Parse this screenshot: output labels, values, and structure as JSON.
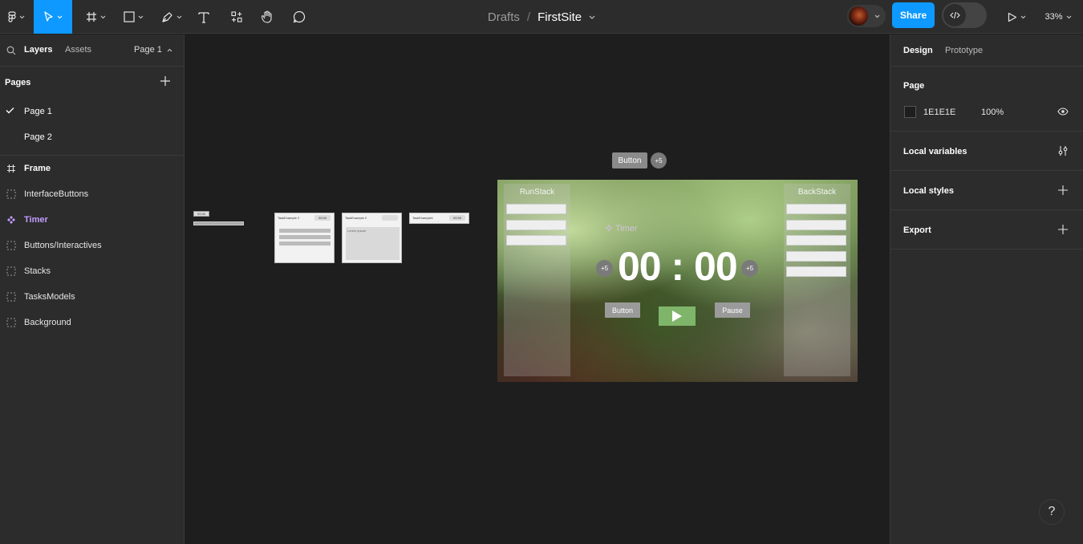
{
  "topbar": {
    "tools": [
      "main-menu",
      "move-tool",
      "frame-tool",
      "shape-tool",
      "pen-tool",
      "text-tool",
      "resources-tool",
      "hand-tool",
      "comment-tool"
    ],
    "breadcrumb": {
      "folder": "Drafts",
      "separator": "/",
      "file": "FirstSite"
    },
    "share_label": "Share",
    "zoom": "33%"
  },
  "left_panel": {
    "tabs": {
      "layers": "Layers",
      "assets": "Assets",
      "page": "Page 1"
    },
    "pages_title": "Pages",
    "pages": [
      {
        "label": "Page 1",
        "selected": true
      },
      {
        "label": "Page 2",
        "selected": false
      }
    ],
    "layers": [
      {
        "label": "Frame",
        "type": "frame"
      },
      {
        "label": "InterfaceButtons",
        "type": "section"
      },
      {
        "label": "Timer",
        "type": "component"
      },
      {
        "label": "Buttons/Interactives",
        "type": "section"
      },
      {
        "label": "Stacks",
        "type": "section"
      },
      {
        "label": "TasksModels",
        "type": "section"
      },
      {
        "label": "Background",
        "type": "section"
      }
    ]
  },
  "right_panel": {
    "tabs": {
      "design": "Design",
      "prototype": "Prototype"
    },
    "page_section": {
      "title": "Page",
      "color_hex": "1E1E1E",
      "opacity": "100%"
    },
    "local_variables": "Local variables",
    "local_styles": "Local styles",
    "export": "Export",
    "help": "?"
  },
  "canvas": {
    "mini_time": "00:00",
    "task_cards": [
      {
        "title": "TaskExample 2",
        "time": "00:00"
      },
      {
        "title": "TaskExample 2",
        "time": "",
        "body": "Lorem ipsum"
      },
      {
        "title": "TaskExample1",
        "time": "00:59"
      }
    ],
    "floating_button": "Button",
    "floating_plus": "+5",
    "frame": {
      "run_stack_title": "RunStack",
      "back_stack_title": "BackStack",
      "timer_label": "Timer",
      "clock": "00 : 00",
      "plus_left": "+5",
      "plus_right": "+5",
      "button_label": "Button",
      "pause_label": "Pause"
    }
  }
}
